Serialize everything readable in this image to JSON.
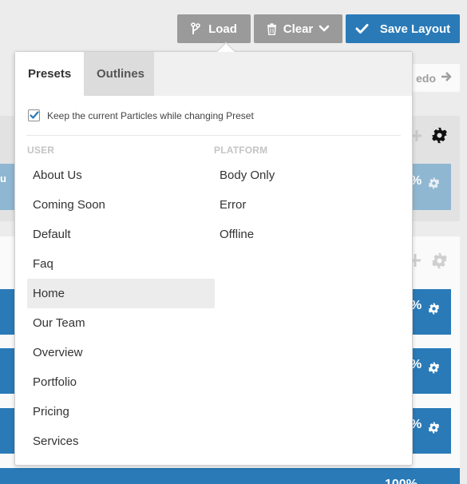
{
  "toolbar": {
    "load_label": "Load",
    "clear_label": "Clear",
    "save_label": "Save Layout",
    "colors": {
      "gray_button": "#9a9a9a",
      "primary_button": "#2a7ab8"
    }
  },
  "background": {
    "redo_label": "edo",
    "row_percent": "%",
    "section1_text": "u",
    "bottom_percent": "100%"
  },
  "popover": {
    "tabs": [
      {
        "label": "Presets",
        "active": true
      },
      {
        "label": "Outlines",
        "active": false
      }
    ],
    "keep_particles": {
      "label": "Keep the current Particles while changing Preset",
      "checked": true
    },
    "user": {
      "heading": "USER",
      "items": [
        {
          "label": "About Us"
        },
        {
          "label": "Coming Soon"
        },
        {
          "label": "Default"
        },
        {
          "label": "Faq"
        },
        {
          "label": "Home",
          "highlighted": true
        },
        {
          "label": "Our Team"
        },
        {
          "label": "Overview"
        },
        {
          "label": "Portfolio"
        },
        {
          "label": "Pricing"
        },
        {
          "label": "Services"
        }
      ]
    },
    "platform": {
      "heading": "PLATFORM",
      "items": [
        {
          "label": "Body Only"
        },
        {
          "label": "Error"
        },
        {
          "label": "Offline"
        }
      ]
    }
  }
}
